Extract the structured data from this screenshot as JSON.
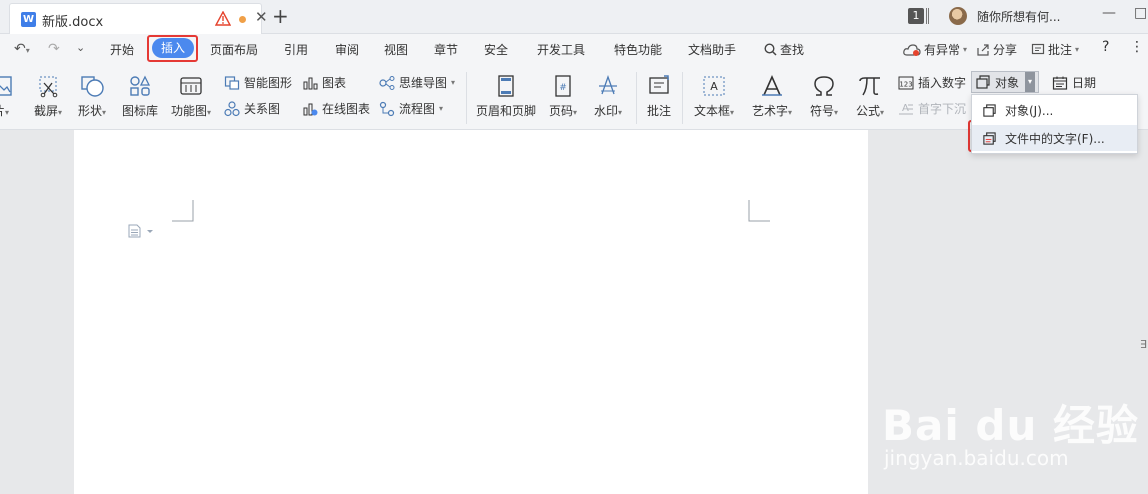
{
  "titlebar": {
    "doc_tab": "新版.docx",
    "doc_icon_letter": "W",
    "notification_count": "1",
    "user_text": "随你所想有何..."
  },
  "menu": {
    "items": [
      "开始",
      "插入",
      "页面布局",
      "引用",
      "审阅",
      "视图",
      "章节",
      "安全",
      "开发工具",
      "特色功能",
      "文档助手",
      "查找"
    ],
    "active": "插入",
    "right": {
      "exception": "有异常",
      "share": "分享",
      "comment": "批注",
      "help": "?"
    }
  },
  "ribbon": {
    "picture_partial": "片",
    "screenshot": "截屏",
    "shape": "形状",
    "icon_library": "图标库",
    "function_chart": "功能图",
    "smart_shape": "智能图形",
    "chart": "图表",
    "mind_map": "思维导图",
    "relation_chart": "关系图",
    "online_chart": "在线图表",
    "flow_chart": "流程图",
    "header_footer": "页眉和页脚",
    "page_number": "页码",
    "watermark": "水印",
    "comment": "批注",
    "text_box": "文本框",
    "art_text": "艺术字",
    "symbol": "符号",
    "formula": "公式",
    "insert_number": "插入数字",
    "object": "对象",
    "date": "日期",
    "drop_cap": "首字下沉"
  },
  "dropdown": {
    "items": [
      "对象(J)...",
      "文件中的文字(F)..."
    ],
    "highlighted": "文件中的文字(F)..."
  },
  "watermark_text": {
    "main": "Bai du 经验",
    "sub": "jingyan.baidu.com"
  },
  "colors": {
    "accent": "#4b89ee",
    "highlight_box": "#e53935"
  }
}
